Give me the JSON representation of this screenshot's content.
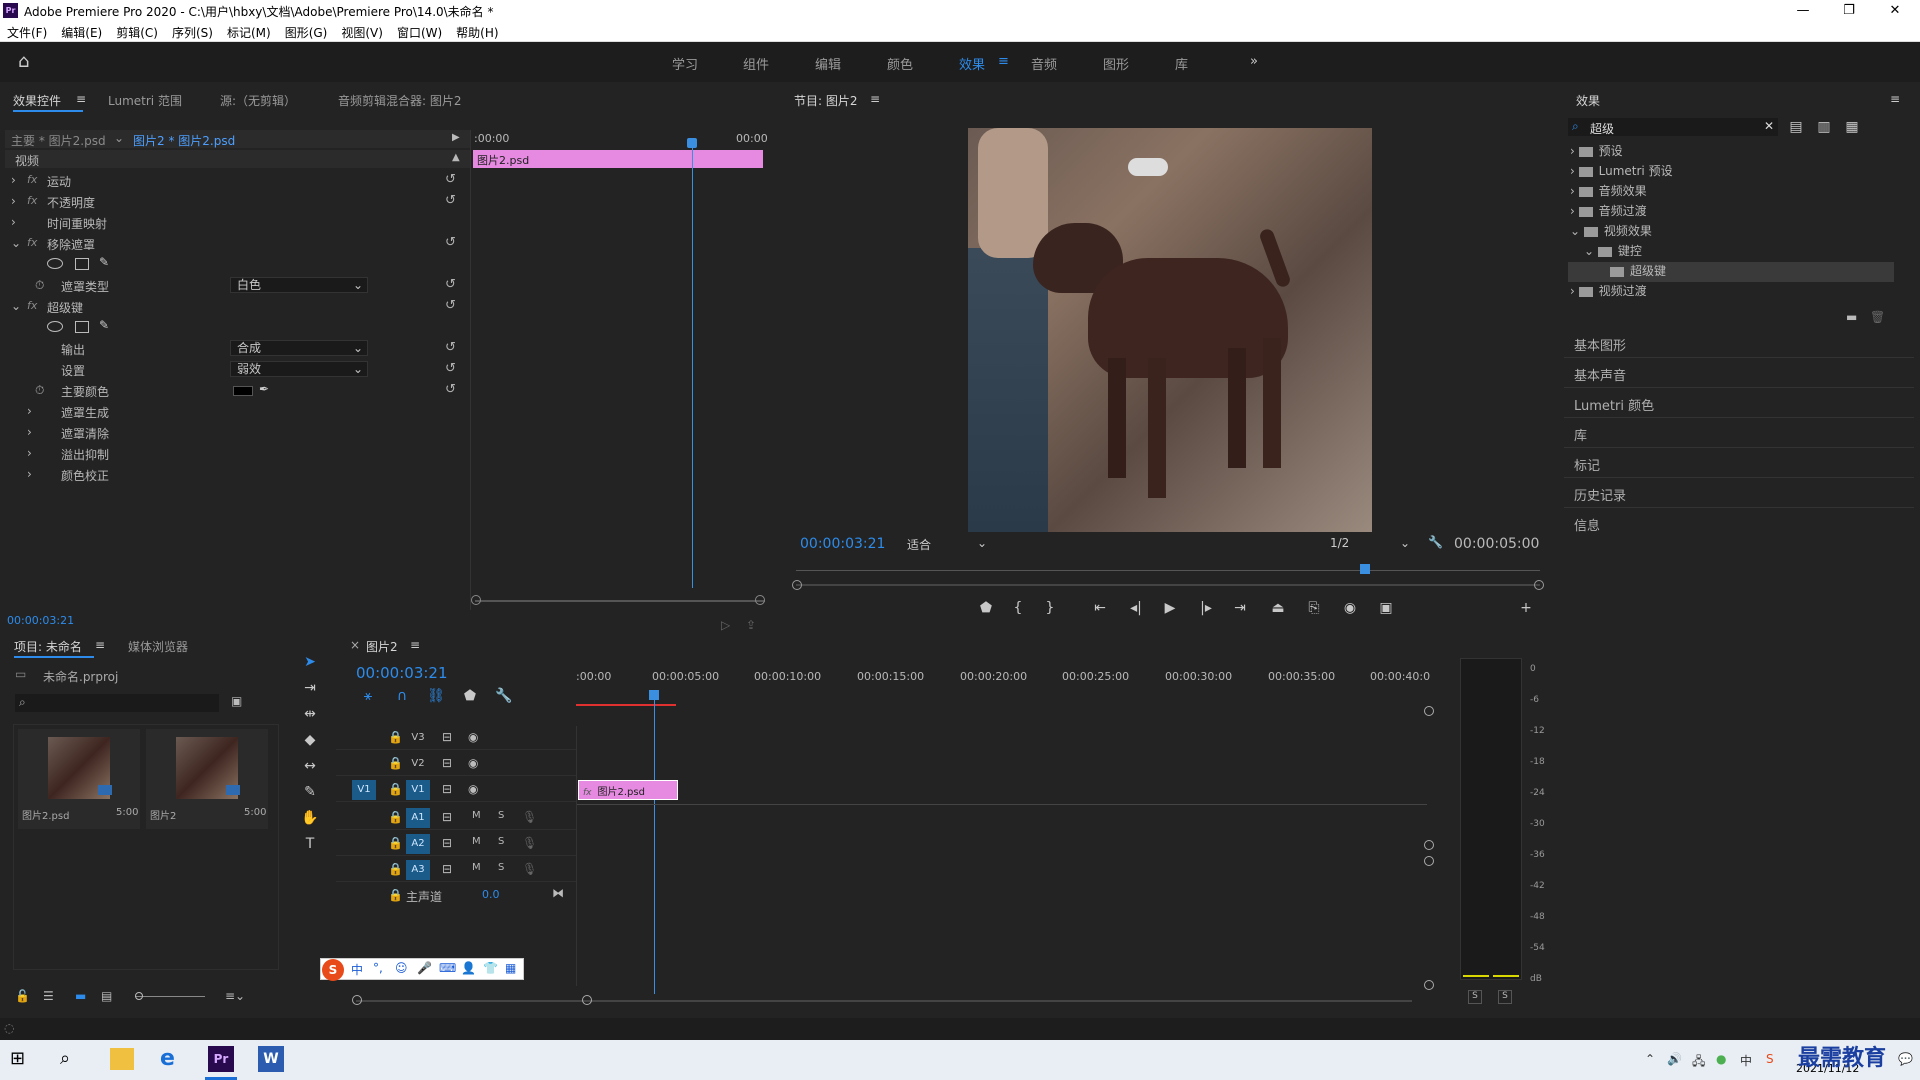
{
  "title": "Adobe Premiere Pro 2020 - C:\\用户\\hbxy\\文档\\Adobe\\Premiere Pro\\14.0\\未命名 *",
  "app_icon": "Pr",
  "menu": [
    "文件(F)",
    "编辑(E)",
    "剪辑(C)",
    "序列(S)",
    "标记(M)",
    "图形(G)",
    "视图(V)",
    "窗口(W)",
    "帮助(H)"
  ],
  "workspaces": [
    "学习",
    "组件",
    "编辑",
    "颜色",
    "效果",
    "音频",
    "图形",
    "库"
  ],
  "active_workspace": "效果",
  "effect_controls": {
    "tabs": [
      "效果控件",
      "Lumetri 范围",
      "源:（无剪辑）",
      "音频剪辑混合器: 图片2"
    ],
    "master": "主要 * 图片2.psd",
    "clip": "图片2 * 图片2.psd",
    "time_start": ":00:00",
    "time_end": "00:00",
    "clip_label": "图片2.psd",
    "section": "视频",
    "rows": {
      "motion": "运动",
      "opacity": "不透明度",
      "timeremap": "时间重映射",
      "removematte": "移除遮罩",
      "matte_type_label": "遮罩类型",
      "matte_type_value": "白色",
      "ultrakey": "超级键",
      "output_label": "输出",
      "output_value": "合成",
      "setting_label": "设置",
      "setting_value": "弱效",
      "key_color_label": "主要颜色",
      "matte_gen": "遮罩生成",
      "matte_cleanup": "遮罩清除",
      "spill": "溢出抑制",
      "color_correct": "颜色校正"
    },
    "fx_label": "fx",
    "footer_time": "00:00:03:21"
  },
  "program": {
    "title": "节目: 图片2",
    "timecode": "00:00:03:21",
    "fit": "适合",
    "quality": "1/2",
    "duration": "00:00:05:00"
  },
  "effects_panel": {
    "title": "效果",
    "search": "超级",
    "tree": [
      "预设",
      "Lumetri 预设",
      "音频效果",
      "音频过渡",
      "视频效果",
      "键控",
      "超级键",
      "视频过渡"
    ],
    "sections": [
      "基本图形",
      "基本声音",
      "Lumetri 颜色",
      "库",
      "标记",
      "历史记录",
      "信息"
    ]
  },
  "project": {
    "tabs": [
      "项目: 未命名",
      "媒体浏览器"
    ],
    "file": "未命名.prproj",
    "items": [
      {
        "name": "图片2.psd",
        "duration": "5:00"
      },
      {
        "name": "图片2",
        "duration": "5:00"
      }
    ]
  },
  "timeline": {
    "tab": "图片2",
    "timecode": "00:00:03:21",
    "ruler": [
      ":00:00",
      "00:00:05:00",
      "00:00:10:00",
      "00:00:15:00",
      "00:00:20:00",
      "00:00:25:00",
      "00:00:30:00",
      "00:00:35:00",
      "00:00:40:0"
    ],
    "video_tracks": [
      "V3",
      "V2",
      "V1"
    ],
    "audio_tracks": [
      "A1",
      "A2",
      "A3"
    ],
    "source_patch": "V1",
    "master_label": "主声道",
    "master_value": "0.0",
    "clip": "图片2.psd",
    "fx_badge": "fx",
    "mute": "M",
    "solo": "S"
  },
  "meter": {
    "labels": [
      "0",
      "-6",
      "-12",
      "-18",
      "-24",
      "-30",
      "-36",
      "-42",
      "-48",
      "-54",
      "dB"
    ],
    "solo": [
      "S",
      "S"
    ]
  },
  "ime": [
    "中",
    "°,",
    "☺",
    "🎤",
    "⌨",
    "👤",
    "👕",
    "▦"
  ],
  "taskbar": {
    "date": "2021/11/12",
    "watermark": "最需教育"
  },
  "colors": {
    "accent": "#2d8ceb",
    "clip_pink": "#e58ae0",
    "playhead": "#3a8fe0",
    "panel": "#232323"
  }
}
